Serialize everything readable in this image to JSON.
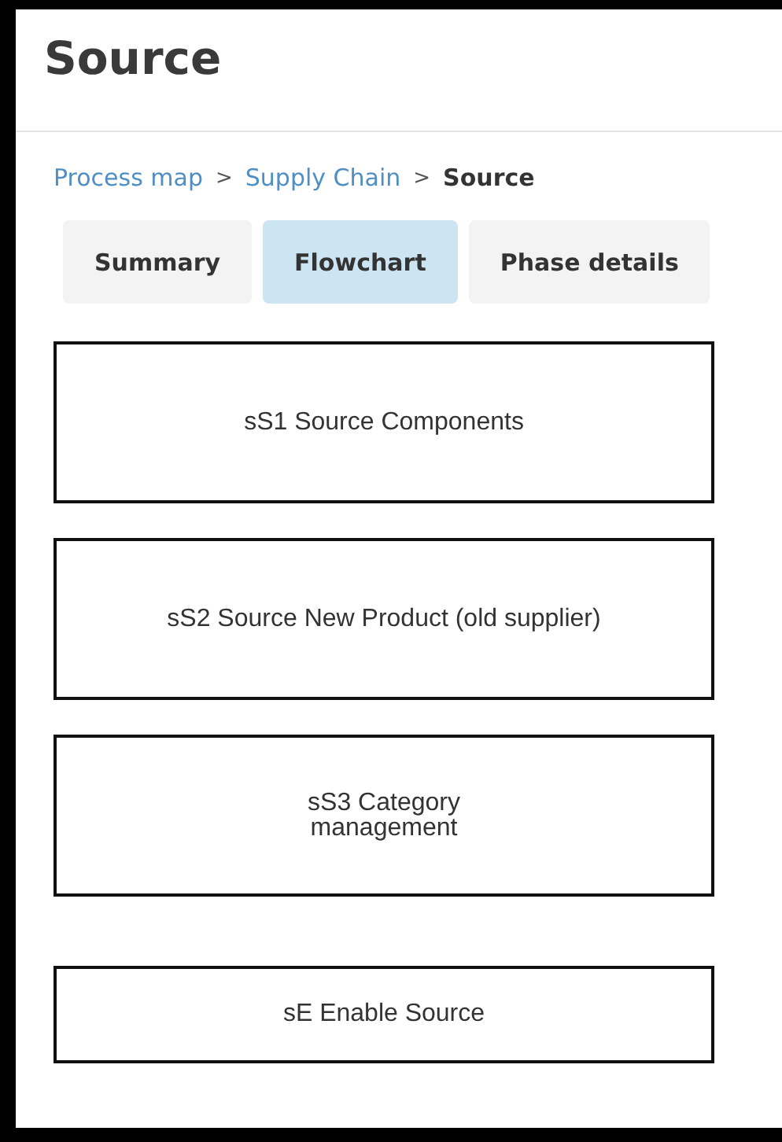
{
  "title": "Source",
  "breadcrumb": [
    {
      "label": "Process map",
      "kind": "link"
    },
    {
      "label": "Supply Chain",
      "kind": "link"
    },
    {
      "label": "Source",
      "kind": "current"
    }
  ],
  "separator": ">",
  "tabs": [
    {
      "label": "Summary",
      "selected": false
    },
    {
      "label": "Flowchart",
      "selected": true
    },
    {
      "label": "Phase details",
      "selected": false
    }
  ],
  "flowchart": [
    {
      "label": "sS1 Source Components",
      "kind": "tall"
    },
    {
      "label": "sS2 Source New Product (old supplier)",
      "kind": "tall"
    },
    {
      "label": "sS3 Category\nmanagement",
      "kind": "tall"
    },
    {
      "label": "sE Enable Source",
      "kind": "short"
    }
  ]
}
